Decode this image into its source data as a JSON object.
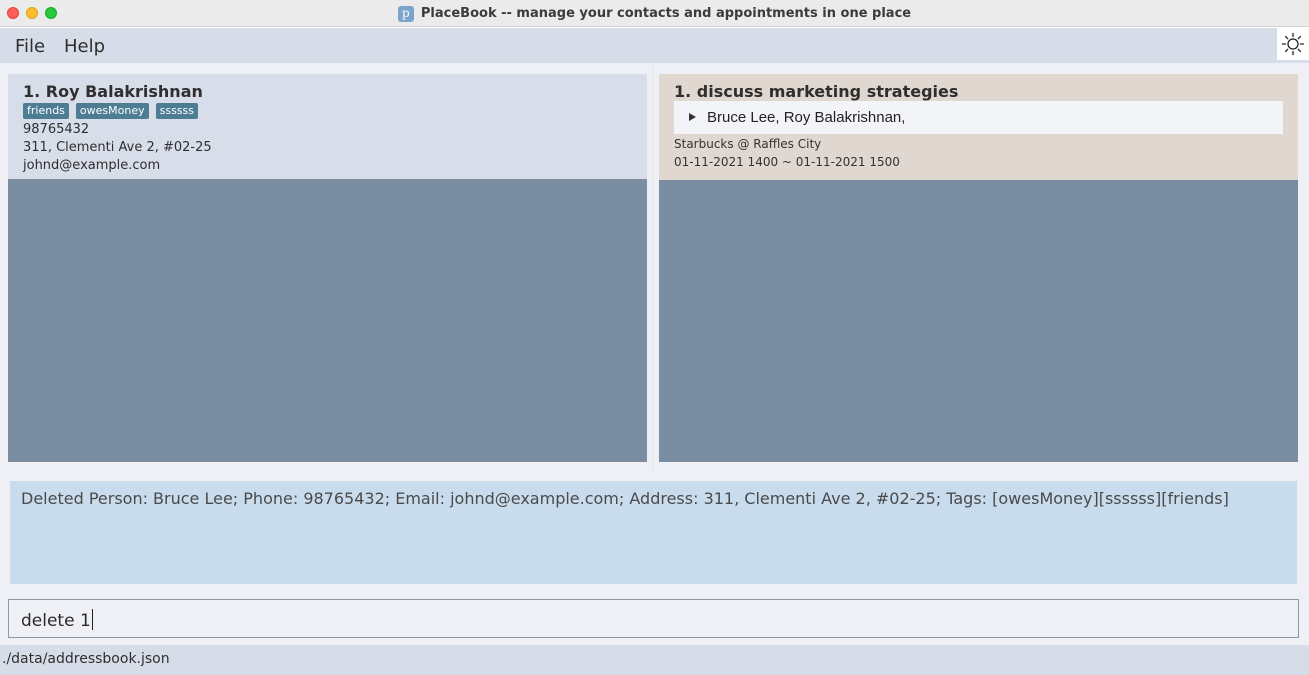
{
  "window": {
    "title": "PlaceBook -- manage your contacts and appointments in one place",
    "app_icon_letter": "p"
  },
  "menu": {
    "file": "File",
    "help": "Help",
    "theme_toggle_icon": "sun-icon"
  },
  "person_list": {
    "persons": [
      {
        "index_name": "1.  Roy Balakrishnan",
        "tags": [
          "friends",
          "owesMoney",
          "ssssss"
        ],
        "phone": "98765432",
        "address": "311, Clementi Ave 2, #02-25",
        "email": "johnd@example.com"
      }
    ]
  },
  "appointment_list": {
    "appointments": [
      {
        "index_title": "1.  discuss marketing strategies",
        "clients": "Bruce Lee, Roy Balakrishnan,",
        "location": "Starbucks @ Raffles City",
        "time_range": "01-11-2021 1400  ~  01-11-2021 1500"
      }
    ]
  },
  "result": {
    "text": "Deleted Person: Bruce Lee; Phone: 98765432; Email: johnd@example.com; Address: 311, Clementi Ave 2, #02-25; Tags: [owesMoney][ssssss][friends]"
  },
  "command_box": {
    "value": "delete 1"
  },
  "status_bar": {
    "file_path": "./data/addressbook.json"
  },
  "colors": {
    "menubar": "#d7dde8",
    "panel_bg": "#7b8da1",
    "person_card": "#d7dde9",
    "appointment_card": "#e0d8d0",
    "tag": "#4c7d93",
    "result_box": "#c9dcee"
  }
}
